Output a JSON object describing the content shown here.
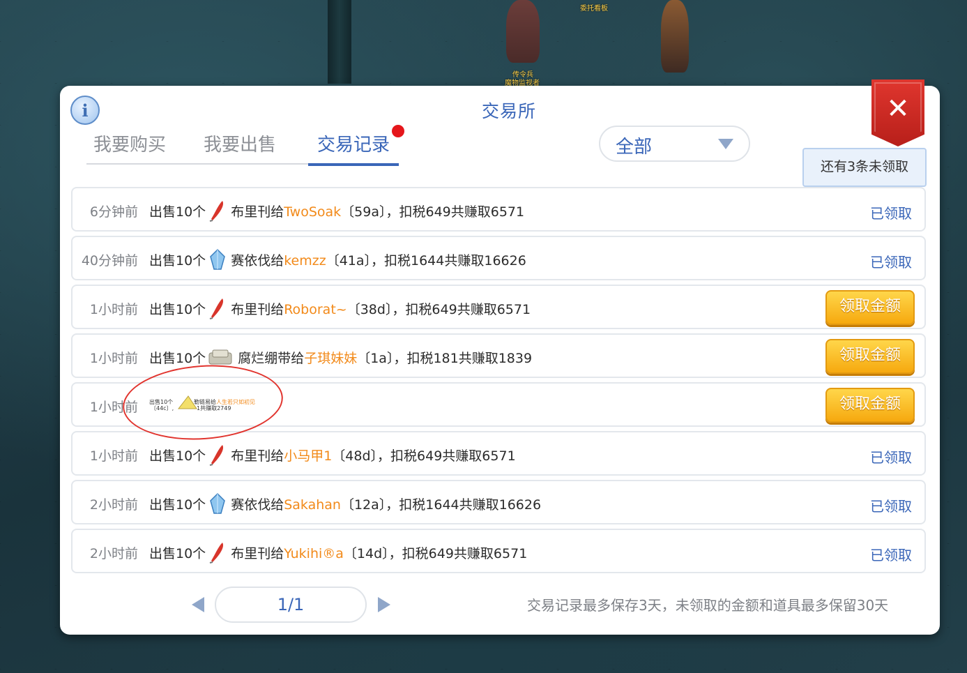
{
  "scene": {
    "npc_labels": [
      "委托看板",
      "传令兵",
      "魔物监视者"
    ]
  },
  "panel": {
    "title": "交易所",
    "info_icon": "info-icon",
    "close_icon": "close-icon",
    "close_symbol": "✕"
  },
  "tabs": [
    {
      "label": "我要购买",
      "active": false
    },
    {
      "label": "我要出售",
      "active": false
    },
    {
      "label": "交易记录",
      "active": true,
      "badge": "red-dot"
    }
  ],
  "filter": {
    "selected": "全部"
  },
  "unclaimed_notice": "还有3条未领取",
  "records": [
    {
      "time": "6分钟前",
      "prefix": "出售10个",
      "icon": "red-feather-icon",
      "item_to": "布里刊给",
      "buyer": "TwoSoak",
      "suffix": "〔59a〕，扣税649共赚取6571",
      "status": "claimed",
      "status_label": "已领取"
    },
    {
      "time": "40分钟前",
      "prefix": "出售10个",
      "icon": "blue-crystal-icon",
      "item_to": "赛依伐给",
      "buyer": "kemzz",
      "suffix": "〔41a〕，扣税1644共赚取16626",
      "status": "claimed",
      "status_label": "已领取"
    },
    {
      "time": "1小时前",
      "prefix": "出售10个",
      "icon": "red-feather-icon",
      "item_to": "布里刊给",
      "buyer": "Roborat~",
      "suffix": "〔38d〕，扣税649共赚取6571",
      "status": "unclaimed",
      "status_label": "领取金额"
    },
    {
      "time": "1小时前",
      "prefix": "出售10个",
      "icon": "bandage-icon",
      "item_to": "腐烂绷带给",
      "buyer": "子琪妹妹",
      "suffix": "〔1a〕，扣税181共赚取1839",
      "status": "unclaimed",
      "status_label": "领取金额"
    },
    {
      "time": "1小时前",
      "tiny_line1": "出售10个",
      "tiny_buyer_prefix": "勒链易给",
      "tiny_buyer": "人生若只如初见",
      "tiny_line2a": "〔44c〕,",
      "tiny_line2b": "1共赚取2749",
      "icon": "cheese-icon",
      "status": "unclaimed",
      "status_label": "领取金额"
    },
    {
      "time": "1小时前",
      "prefix": "出售10个",
      "icon": "red-feather-icon",
      "item_to": "布里刊给",
      "buyer": "小马甲1",
      "suffix": "〔48d〕，扣税649共赚取6571",
      "status": "claimed",
      "status_label": "已领取"
    },
    {
      "time": "2小时前",
      "prefix": "出售10个",
      "icon": "blue-crystal-icon",
      "item_to": "赛依伐给",
      "buyer": "Sakahan",
      "suffix": "〔12a〕，扣税1644共赚取16626",
      "status": "claimed",
      "status_label": "已领取"
    },
    {
      "time": "2小时前",
      "prefix": "出售10个",
      "icon": "red-feather-icon",
      "item_to": "布里刊给",
      "buyer": "Yukihi®a",
      "suffix": "〔14d〕，扣税649共赚取6571",
      "status": "claimed",
      "status_label": "已领取"
    }
  ],
  "pagination": {
    "current": "1/1"
  },
  "footnote": "交易记录最多保存3天，未领取的金额和道具最多保留30天",
  "colors": {
    "accent": "#3a66b8",
    "buyer": "#f28a1a",
    "claim_button": "#f6a90f",
    "close": "#d22b25",
    "badge": "#e5161b",
    "annotation": "#e1342e"
  }
}
